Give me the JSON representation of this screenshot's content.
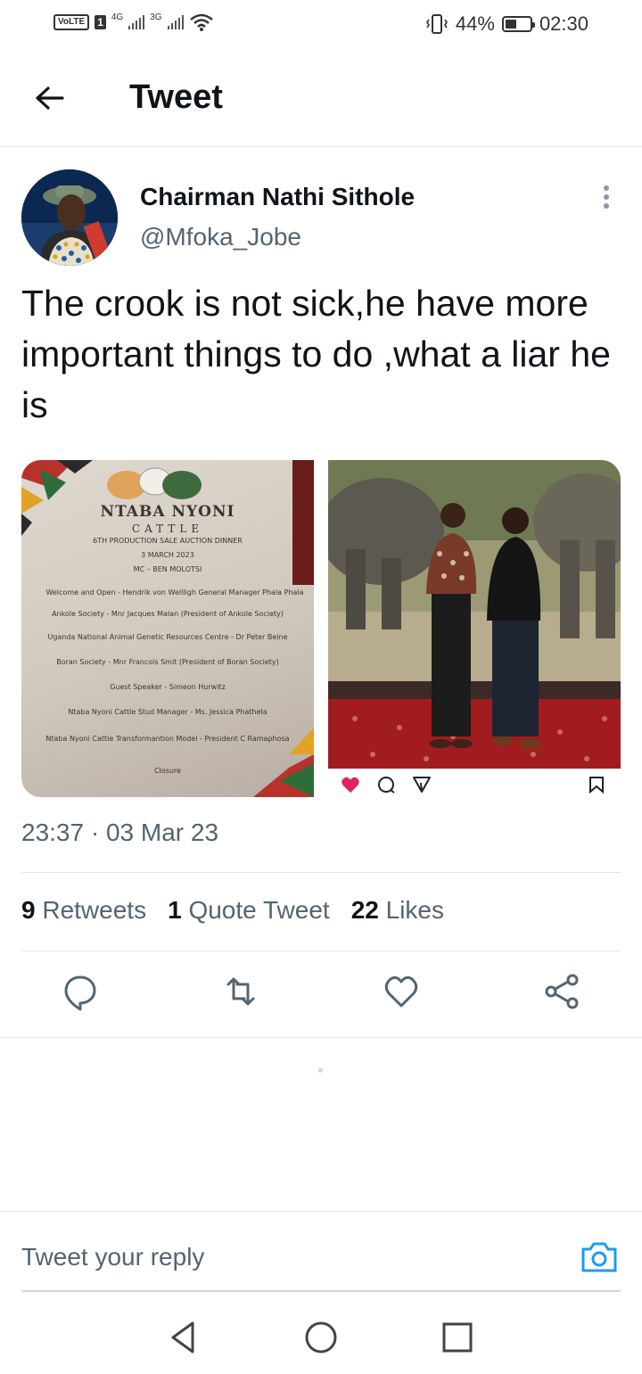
{
  "status_bar": {
    "volte": "VoLTE",
    "sim": "1",
    "net1": "4G",
    "net2": "3G",
    "battery": "44%",
    "time": "02:30"
  },
  "header": {
    "title": "Tweet"
  },
  "tweet": {
    "author_name": "Chairman Nathi Sithole",
    "author_handle": "@Mfoka_Jobe",
    "text": "The crook is not sick,he have more important things to do ,what a liar he is",
    "timestamp": "23:37 · 03 Mar 23",
    "media_left": {
      "title": "NTABA NYONI",
      "subtitle": "CATTLE",
      "lines": [
        "6TH PRODUCTION SALE AUCTION DINNER",
        "3 MARCH 2023",
        "MC – BEN MOLOTSI",
        "Welcome and Open - Hendrik von Wellligh General Manager Phala Phala",
        "Ankole Society - Mnr Jacques Malan (President of Ankole Society)",
        "Uganda National Animal Genetic Resources Centre - Dr Peter Beine",
        "Boran Society - Mnr Francois Smit (President of Boran Society)",
        "Guest Speaker - Simeon Hurwitz",
        "Ntaba Nyoni Cattle Stud Manager - Ms. Jessica Phathela",
        "Ntaba Nyoni Cattle Transformantion Model - President C Ramaphosa",
        "Closure"
      ]
    },
    "stats": [
      {
        "count": "9",
        "label": "Retweets"
      },
      {
        "count": "1",
        "label": "Quote Tweet"
      },
      {
        "count": "22",
        "label": "Likes"
      }
    ],
    "actions": [
      "reply-icon",
      "retweet-icon",
      "like-icon",
      "share-icon"
    ]
  },
  "reply": {
    "placeholder": "Tweet your reply"
  },
  "colors": {
    "accent": "#1d9bf0",
    "secondary_text": "#536471",
    "like_red": "#e0245e"
  }
}
